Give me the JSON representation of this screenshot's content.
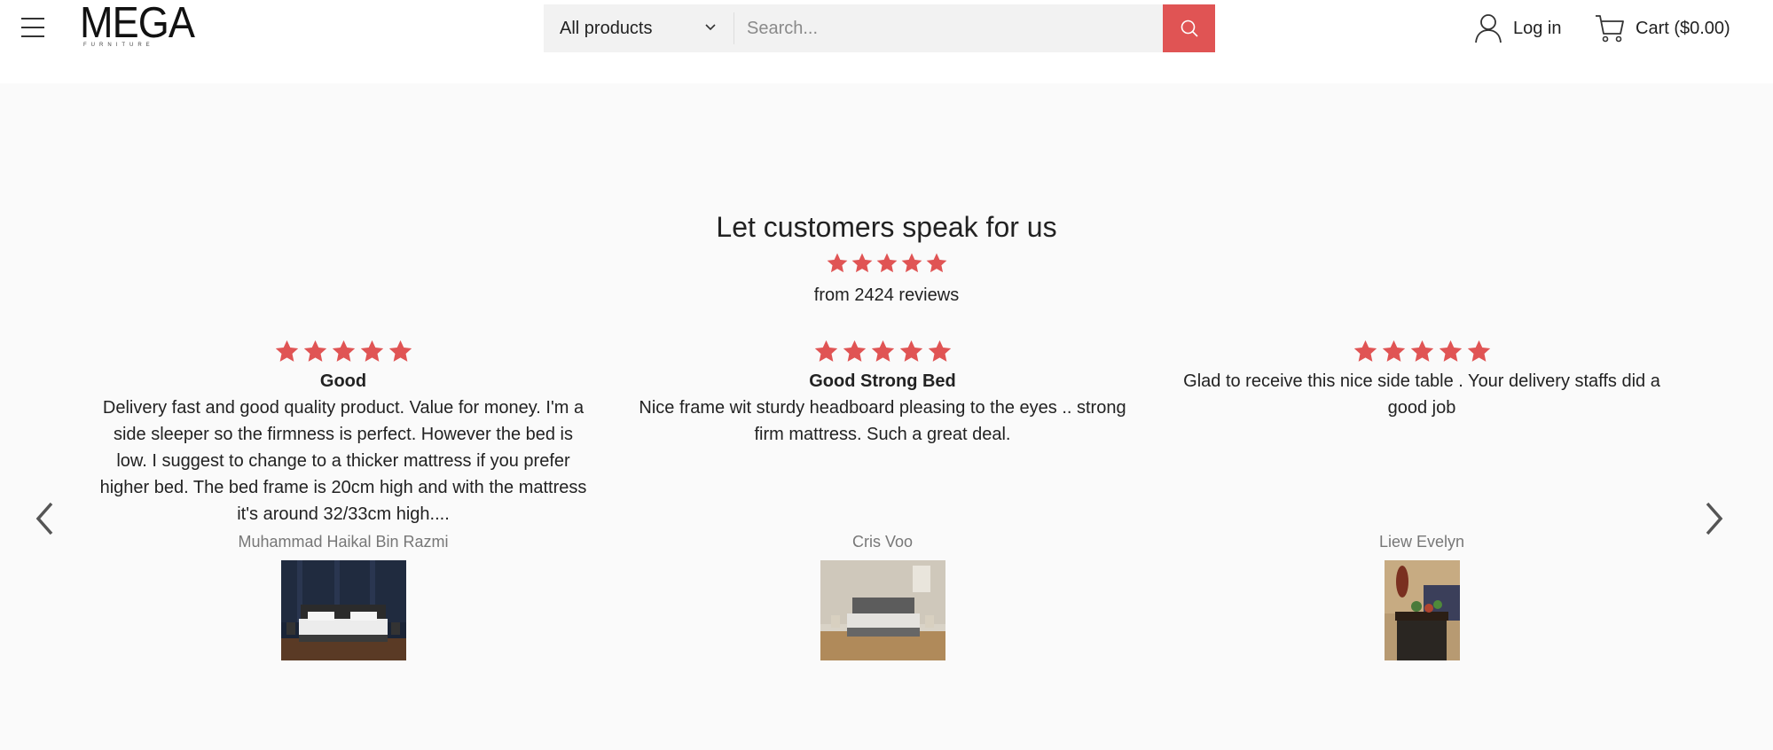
{
  "header": {
    "logo": {
      "main": "MEGA",
      "sub": "FURNITURE"
    },
    "search": {
      "category_selected": "All products",
      "placeholder": "Search..."
    },
    "login_label": "Log in",
    "cart_label": "Cart ($0.00)"
  },
  "colors": {
    "accent": "#e05454",
    "star": "#e05454",
    "header_bg": "#ffffff",
    "section_bg": "#fafafa"
  },
  "reviews_section": {
    "title": "Let customers speak for us",
    "summary_rating": 5,
    "summary_text": "from 2424 reviews",
    "reviews": [
      {
        "rating": 5,
        "title": "Good",
        "body": "Delivery fast and good quality product. Value for money. I'm a side sleeper so the firmness is perfect. However the bed is low. I suggest to change to a thicker mattress if you prefer higher bed. The bed frame is 20cm high and with the mattress it's around 32/33cm high....",
        "author": "Muhammad Haikal Bin Razmi",
        "photo": "bed-dark-room"
      },
      {
        "rating": 5,
        "title": "Good Strong Bed",
        "body": "Nice frame wit sturdy headboard pleasing to the eyes .. strong firm mattress. Such a great deal.",
        "author": "Cris Voo",
        "photo": "bed-light-room"
      },
      {
        "rating": 5,
        "title": "",
        "body": "Glad to receive this nice side table . Your delivery staffs did a good job",
        "author": "Liew Evelyn",
        "photo": "side-table"
      }
    ]
  },
  "icons": {
    "menu": "hamburger-icon",
    "chevron": "chevron-down-icon",
    "search": "search-icon",
    "user": "user-icon",
    "cart": "cart-icon",
    "prev": "chevron-left-icon",
    "next": "chevron-right-icon",
    "star": "star-icon"
  }
}
